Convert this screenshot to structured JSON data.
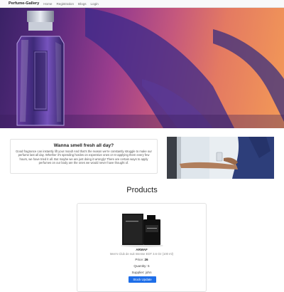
{
  "navbar": {
    "brand": "Perfume-Gallery",
    "links": [
      {
        "label": "Home"
      },
      {
        "label": "Registration"
      },
      {
        "label": "Blogs"
      },
      {
        "label": "Login"
      }
    ]
  },
  "intro": {
    "title": "Wanna smell fresh all day?",
    "text": "Good fragrance can instantly lift your mood! And that's the reason we're constantly struggle to make our perfume last all day. Whether it's spending hordes on expensive ones or re-applying them every few hours, we have tried it all. But maybe we are just doing it wrongly! There are certain ways to apply perfumes on our body are the ones we would never have thought of."
  },
  "products": {
    "title": "Products",
    "items": [
      {
        "brand": "ARMAF",
        "name": "Men's Club de nuit Intense EDT 3.6 Oz (100 ml)",
        "price_label": "Price:",
        "price": "26",
        "quantity_label": "Quantity:",
        "quantity": "5",
        "supplier_label": "Supplier:",
        "supplier": "john",
        "button_label": "Stock Update"
      }
    ]
  },
  "colors": {
    "accent": "#1e6ee8",
    "navbar_bg": "#f8f9fa"
  }
}
